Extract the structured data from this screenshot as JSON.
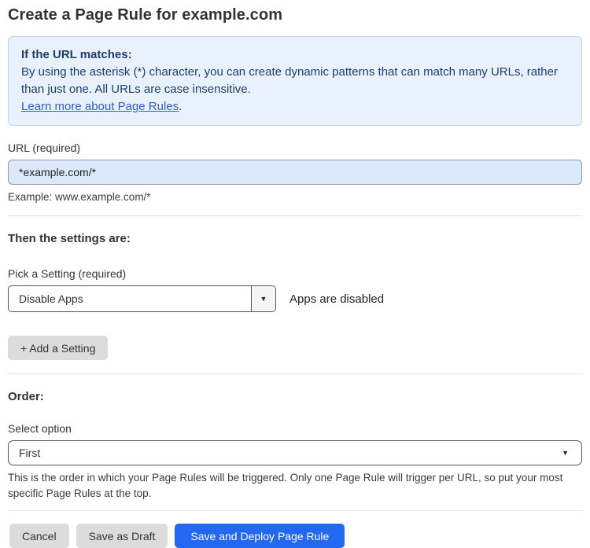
{
  "page": {
    "title": "Create a Page Rule for example.com"
  },
  "info_box": {
    "heading": "If the URL matches:",
    "body": "By using the asterisk (*) character, you can create dynamic patterns that can match many URLs, rather than just one. All URLs are case insensitive.",
    "link_label": "Learn more about Page Rules",
    "link_suffix": "."
  },
  "url_field": {
    "label": "URL (required)",
    "value": "*example.com/*",
    "helper": "Example: www.example.com/*"
  },
  "settings": {
    "heading": "Then the settings are:",
    "picker_label": "Pick a Setting (required)",
    "selected_value": "Disable Apps",
    "dropdown_arrow": "▼",
    "status_text": "Apps are disabled",
    "add_button_label": "+ Add a Setting"
  },
  "order": {
    "heading": "Order:",
    "select_label": "Select option",
    "selected_value": "First",
    "dropdown_arrow": "▼",
    "helper": "This is the order in which your Page Rules will be triggered. Only one Page Rule will trigger per URL, so put your most specific Page Rules at the top."
  },
  "actions": {
    "cancel_label": "Cancel",
    "save_draft_label": "Save as Draft",
    "save_deploy_label": "Save and Deploy Page Rule"
  },
  "colors": {
    "info_box_bg": "#e9f2fc",
    "info_box_border": "#b9d6f2",
    "info_box_text": "#1d3d6e",
    "link_blue": "#2c5fc7",
    "url_input_bg": "#dbe9fb",
    "gray_button_bg": "#dcdcdc",
    "primary_button_bg": "#2268f0"
  }
}
